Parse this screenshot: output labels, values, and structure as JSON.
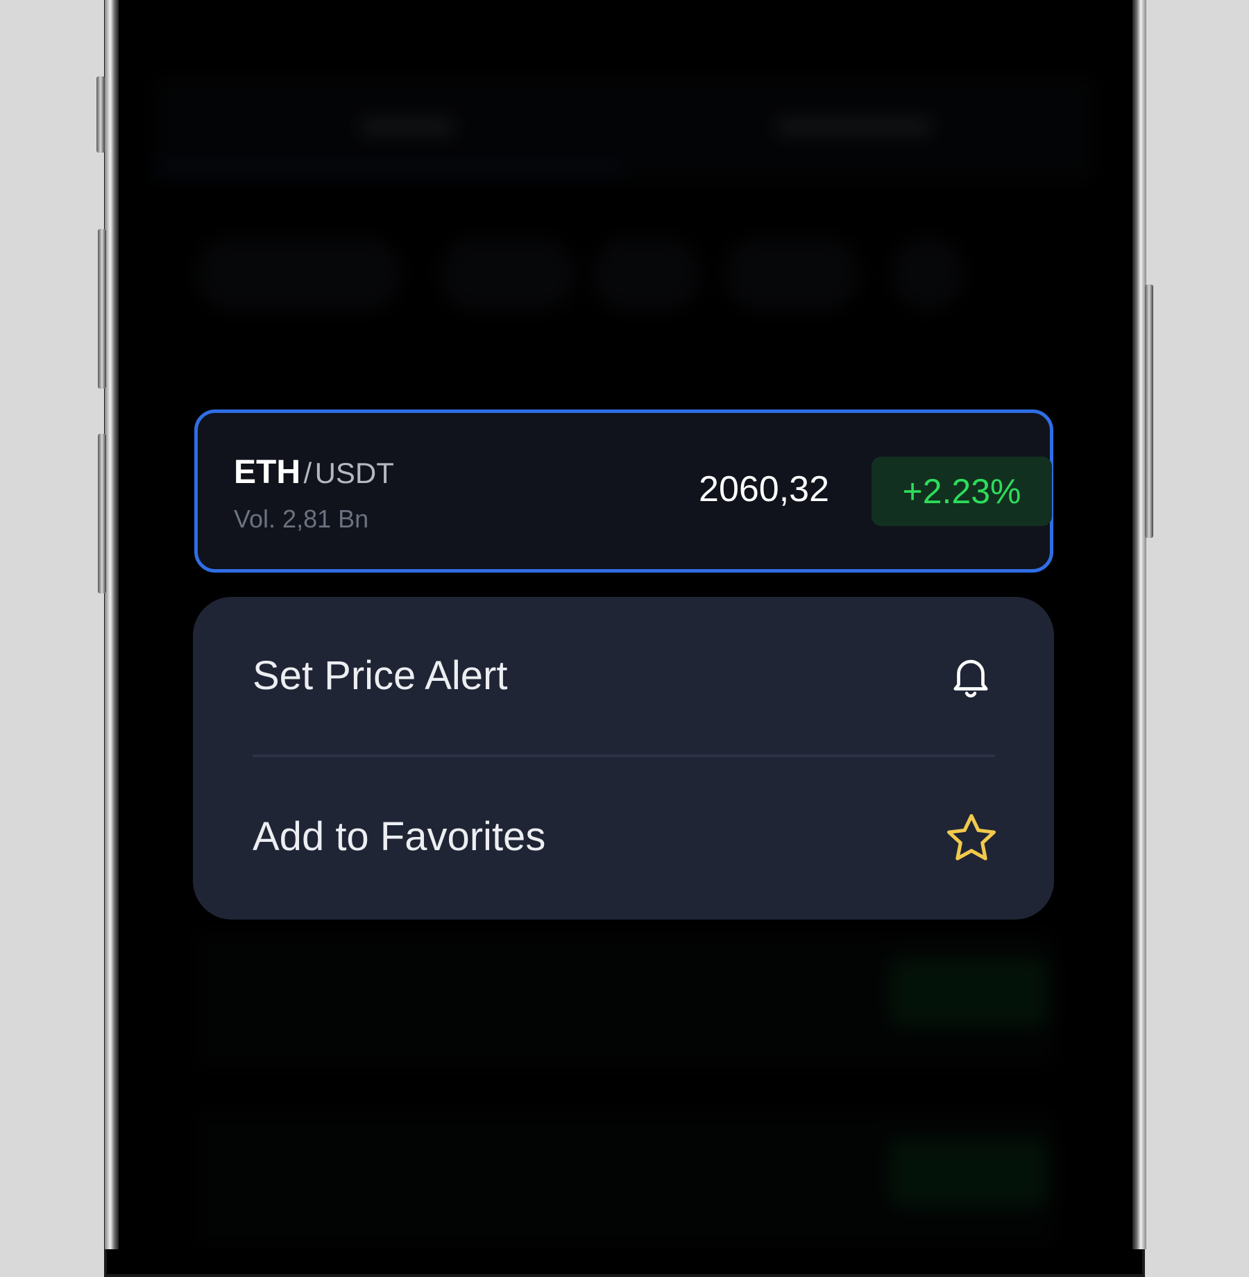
{
  "pair": {
    "base": "ETH",
    "separator": "/",
    "quote": "USDT",
    "volume": "Vol. 2,81 Bn",
    "price": "2060,32",
    "change": "+2.23%"
  },
  "menu": {
    "items": [
      {
        "label": "Set Price Alert",
        "icon": "bell-icon"
      },
      {
        "label": "Add to Favorites",
        "icon": "star-icon"
      }
    ]
  },
  "colors": {
    "highlight_border": "#2f6ee6",
    "positive": "#2ddc5b",
    "star": "#f2c94c",
    "menu_bg": "#1f2535"
  }
}
